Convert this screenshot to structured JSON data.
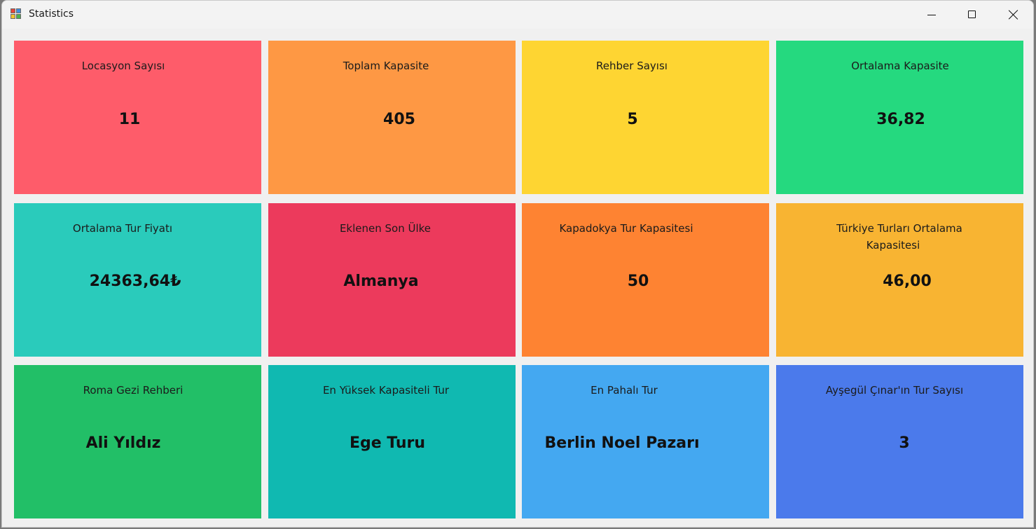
{
  "window": {
    "title": "Statistics",
    "controls": {
      "minimize_icon": "minimize-icon",
      "maximize_icon": "maximize-icon",
      "close_icon": "close-icon"
    }
  },
  "colors": {
    "red": "#fe5c6a",
    "orange": "#fe9844",
    "yellow": "#fed532",
    "green": "#25d97f",
    "teal": "#2acbbb",
    "crimson": "#ec3a5c",
    "dark_orange": "#fe8332",
    "amber": "#f8b432",
    "emerald": "#22bf67",
    "cyan": "#10b9b1",
    "sky": "#44a8f1",
    "blue": "#4b7aeb"
  },
  "cards": [
    {
      "label": "Locasyon Sayısı",
      "value": "11"
    },
    {
      "label": "Toplam Kapasite",
      "value": "405"
    },
    {
      "label": "Rehber Sayısı",
      "value": "5"
    },
    {
      "label": "Ortalama Kapasite",
      "value": "36,82"
    },
    {
      "label": "Ortalama Tur Fiyatı",
      "value": "24363,64₺"
    },
    {
      "label": "Eklenen Son Ülke",
      "value": "Almanya"
    },
    {
      "label": "Kapadokya Tur Kapasitesi",
      "value": "50"
    },
    {
      "label": "Türkiye Turları Ortalama",
      "label2": "Kapasitesi",
      "value": "46,00"
    },
    {
      "label": "Roma Gezi Rehberi",
      "value": "Ali Yıldız"
    },
    {
      "label": "En Yüksek Kapasiteli Tur",
      "value": "Ege Turu"
    },
    {
      "label": "En Pahalı Tur",
      "value": "Berlin Noel Pazarı"
    },
    {
      "label": "Ayşegül Çınar'ın Tur Sayısı",
      "value": "3"
    }
  ]
}
